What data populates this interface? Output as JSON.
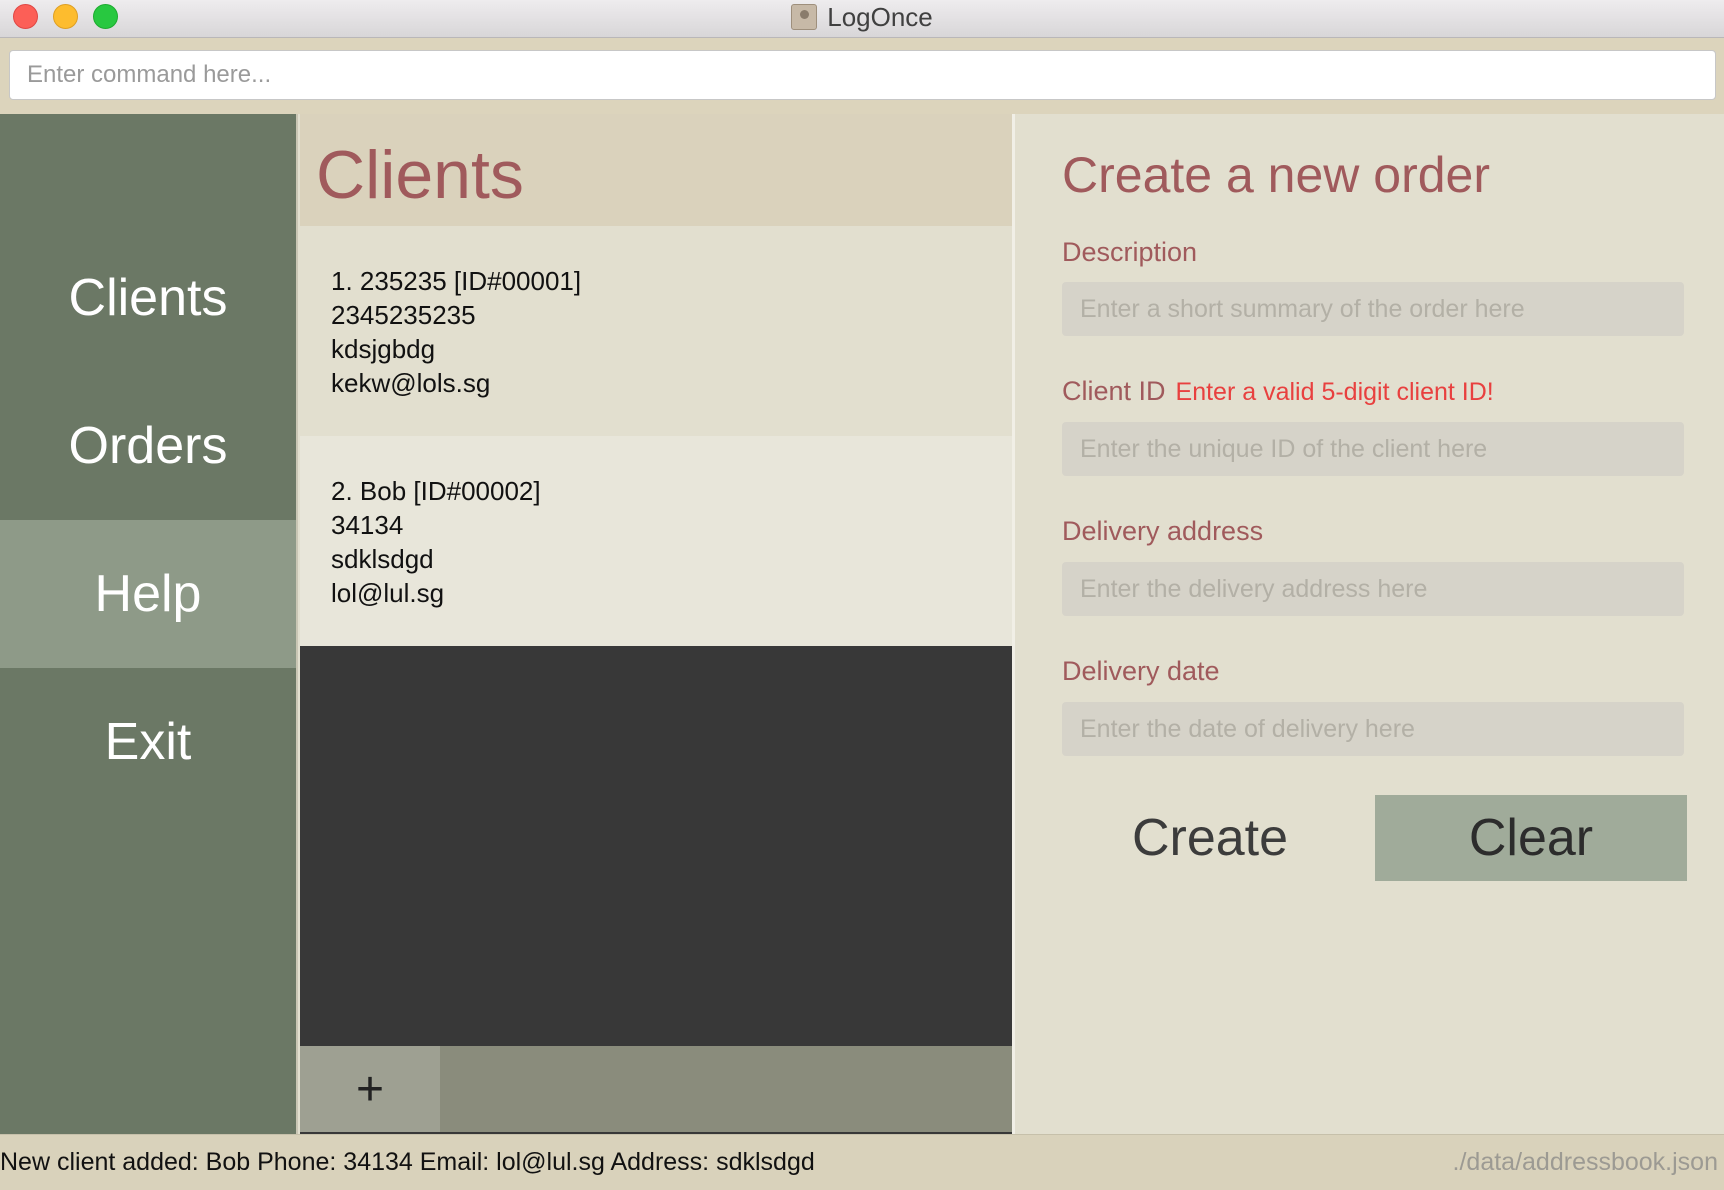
{
  "window": {
    "title": "LogOnce"
  },
  "command": {
    "placeholder": "Enter command here..."
  },
  "sidebar": {
    "items": [
      {
        "label": "Clients"
      },
      {
        "label": "Orders"
      },
      {
        "label": "Help",
        "active": true
      },
      {
        "label": "Exit"
      }
    ]
  },
  "clients": {
    "title": "Clients",
    "list": [
      {
        "header": "1.  235235 [ID#00001]",
        "phone": "2345235235",
        "address": "kdsjgbdg",
        "email": "kekw@lols.sg"
      },
      {
        "header": "2.  Bob [ID#00002]",
        "phone": "34134",
        "address": "sdklsdgd",
        "email": "lol@lul.sg"
      }
    ],
    "add_label": "+"
  },
  "order_form": {
    "title": "Create a new order",
    "description_label": "Description",
    "description_placeholder": "Enter a short summary of the order here",
    "client_id_label": "Client ID",
    "client_id_error": "Enter a valid 5-digit client ID!",
    "client_id_placeholder": "Enter the unique ID of the client here",
    "address_label": "Delivery address",
    "address_placeholder": "Enter the delivery address here",
    "date_label": "Delivery date",
    "date_placeholder": "Enter the date of delivery here",
    "create_label": "Create",
    "clear_label": "Clear"
  },
  "status": {
    "message": "New client added: Bob Phone: 34134 Email: lol@lul.sg Address: sdklsdgd",
    "path": "./data/addressbook.json"
  },
  "colors": {
    "sidebar": "#6b7865",
    "sidebar_active": "#8e9a88",
    "accent_text": "#a05a5c",
    "error_text": "#e8403f",
    "panel_bg": "#e2dfcf",
    "clear_button": "#a0ab9a"
  }
}
